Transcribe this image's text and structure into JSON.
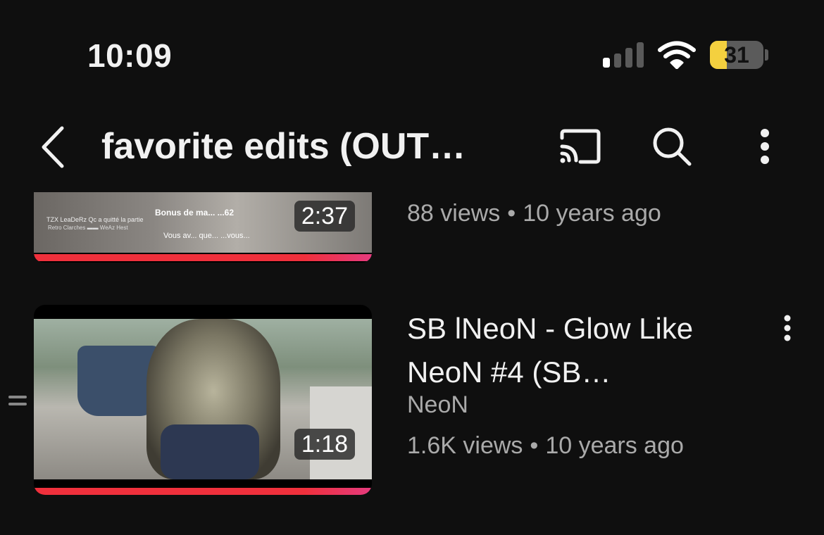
{
  "status_bar": {
    "time": "10:09",
    "battery": "31",
    "battery_level": 0.31
  },
  "header": {
    "title": "favorite edits (OUT…",
    "back_icon": "chevron-left-icon",
    "cast_icon": "cast-icon",
    "search_icon": "search-icon",
    "more_icon": "more-vert-icon"
  },
  "videos": [
    {
      "duration": "2:37",
      "views": "88 views",
      "age": "10 years ago",
      "watched_fraction": 1.0,
      "thumbnail_text": {
        "left_line1": "TZX LeaDeRz Qc a quitté la partie",
        "left_line2": "Retro Clarches ▬▬ WeAz Hest",
        "center_top": "Bonus de ma...   ...62",
        "center_bottom": "Vous av... que... ...vous..."
      }
    },
    {
      "title": "SB lNeoN - Glow Like NeoN #4 (SB…",
      "channel": "NeoN",
      "duration": "1:18",
      "views": "1.6K views",
      "age": "10 years ago",
      "watched_fraction": 1.0
    }
  ],
  "colors": {
    "background": "#0f0f0f",
    "progress": "#f0303c",
    "secondary_text": "#aaaaaa"
  }
}
